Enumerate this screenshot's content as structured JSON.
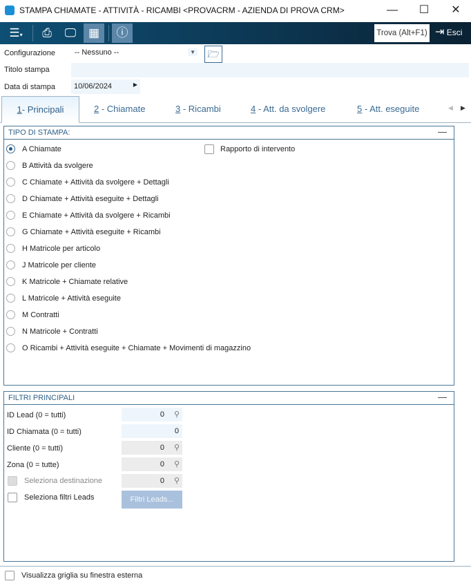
{
  "window": {
    "title": "STAMPA CHIAMATE - ATTIVITÀ - RICAMBI <PROVACRM - AZIENDA DI PROVA CRM>"
  },
  "toolbar": {
    "find_label": "Trova (Alt+F1)",
    "exit_label": "Esci"
  },
  "form": {
    "config_label": "Configurazione",
    "config_value": "-- Nessuno --",
    "title_label": "Titolo stampa",
    "title_value": "",
    "date_label": "Data di stampa",
    "date_value": "10/06/2024"
  },
  "tabs": [
    {
      "key": "1",
      "label": "- Principali"
    },
    {
      "key": "2",
      "label": " - Chiamate"
    },
    {
      "key": "3",
      "label": " - Ricambi"
    },
    {
      "key": "4",
      "label": " - Att. da svolgere"
    },
    {
      "key": "5",
      "label": " - Att. eseguite"
    }
  ],
  "print_type": {
    "title": "TIPO DI STAMPA:",
    "selected": 0,
    "options": [
      "A Chiamate",
      "B Attività da svolgere",
      "C Chiamate + Attività da svolgere + Dettagli",
      "D Chiamate + Attività eseguite + Dettagli",
      "E Chiamate + Attività da svolgere + Ricambi",
      "G Chiamate + Attività eseguite + Ricambi",
      "H Matricole per articolo",
      "J Matricole per cliente",
      "K Matricole + Chiamate relative",
      "L Matricole + Attività eseguite",
      "M Contratti",
      "N Matricole + Contratti",
      "O Ricambi + Attività eseguite + Chiamate + Movimenti di magazzino"
    ],
    "report_label": "Rapporto di intervento"
  },
  "filters": {
    "title": "FILTRI PRINCIPALI",
    "id_lead_label": "ID Lead (0 = tutti)",
    "id_lead": "0",
    "id_call_label": "ID Chiamata (0 = tutti)",
    "id_call": "0",
    "client_label": "Cliente (0 = tutti)",
    "client": "0",
    "zone_label": "Zona (0 = tutte)",
    "zone": "0",
    "dest_label": "Seleziona destinazione",
    "dest": "0",
    "leads_filter_label": "Seleziona filtri Leads",
    "leads_button": "Filtri Leads..."
  },
  "footer": {
    "external_grid_label": "Visualizza griglia su finestra esterna"
  }
}
